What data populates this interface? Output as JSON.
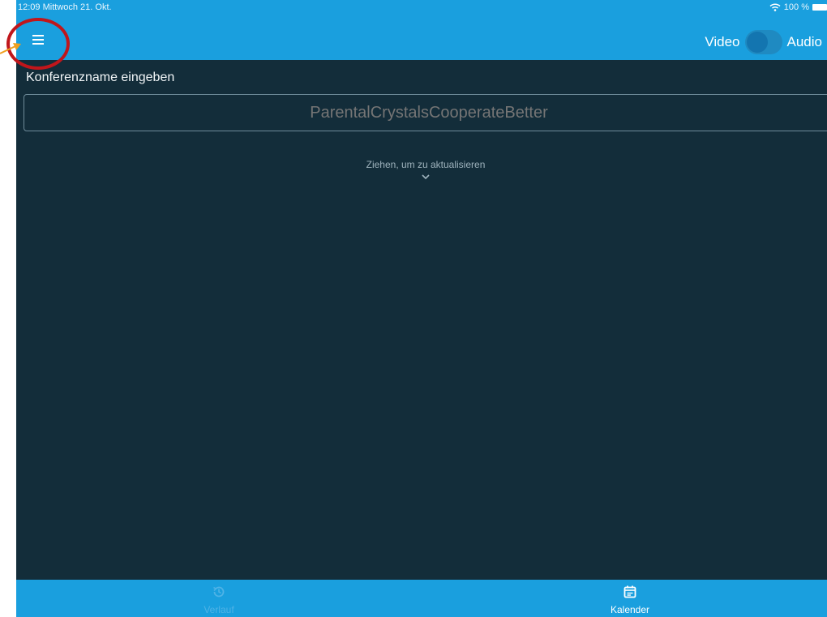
{
  "status_bar": {
    "time": "12:09",
    "date": "Mittwoch 21. Okt.",
    "battery": "100 %"
  },
  "topbar": {
    "menu_icon": "hamburger-menu-icon",
    "video_label": "Video",
    "audio_label": "Audio",
    "toggle_state": "off"
  },
  "main": {
    "room_label": "Konferenzname eingeben",
    "room_value": "ParentalCrystalsCooperateBetter",
    "pull_hint": "Ziehen, um zu aktualisieren"
  },
  "tabbar": {
    "tabs": [
      {
        "label": "Verlauf",
        "icon": "history-icon",
        "active": false
      },
      {
        "label": "Kalender",
        "icon": "calendar-icon",
        "active": true
      }
    ]
  },
  "colors": {
    "accent": "#1a9fde",
    "background": "#132d3a",
    "annotation": "#c0161b",
    "arrow": "#f0a020"
  }
}
